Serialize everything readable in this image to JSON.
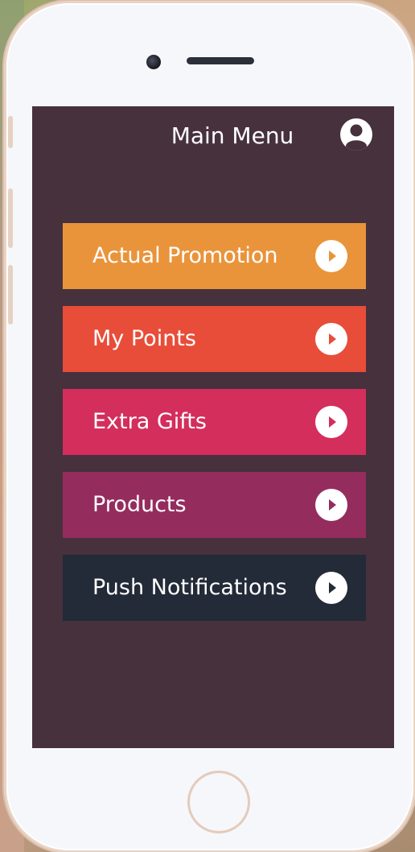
{
  "header": {
    "title": "Main Menu",
    "avatar_icon": "user-icon"
  },
  "menu": {
    "items": [
      {
        "label": "Actual Promotion",
        "color": "#e9943b",
        "icon": "chevron-right-circle-icon"
      },
      {
        "label": "My Points",
        "color": "#e84d39",
        "icon": "chevron-right-circle-icon"
      },
      {
        "label": "Extra Gifts",
        "color": "#d42e5c",
        "icon": "chevron-right-circle-icon"
      },
      {
        "label": "Products",
        "color": "#952c5e",
        "icon": "chevron-right-circle-icon"
      },
      {
        "label": "Push Notifications",
        "color": "#232a38",
        "icon": "chevron-right-circle-icon"
      }
    ]
  },
  "colors": {
    "screen_background": "#46313d",
    "device_frame": "#f6f7fa"
  }
}
